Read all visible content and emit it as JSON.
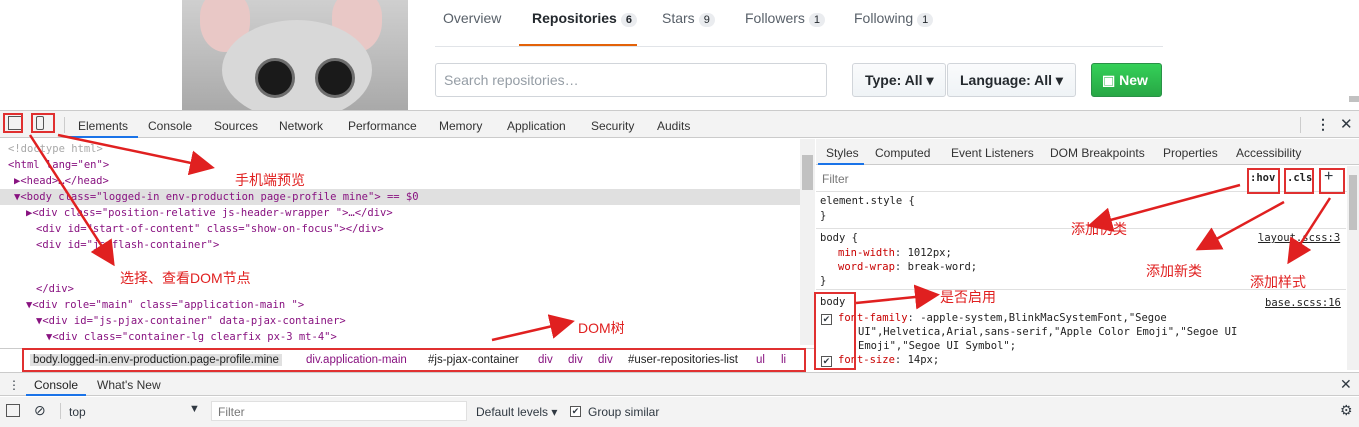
{
  "github": {
    "nav": [
      {
        "label": "Overview",
        "count": ""
      },
      {
        "label": "Repositories",
        "count": "6"
      },
      {
        "label": "Stars",
        "count": "9"
      },
      {
        "label": "Followers",
        "count": "1"
      },
      {
        "label": "Following",
        "count": "1"
      }
    ],
    "search_placeholder": "Search repositories…",
    "type_label": "Type: All ▾",
    "language_label": "Language: All ▾",
    "new_label": "New"
  },
  "devtools": {
    "tabs": [
      "Elements",
      "Console",
      "Sources",
      "Network",
      "Performance",
      "Memory",
      "Application",
      "Security",
      "Audits"
    ],
    "active_tab": "Elements",
    "dom_lines": [
      "<!doctype html>",
      "<html lang=\"en\">",
      "▶<head>…</head>",
      "▼<body class=\"logged-in env-production page-profile mine\"> == $0",
      "▶<div class=\"position-relative js-header-wrapper \">…</div>",
      "<div id=\"start-of-content\" class=\"show-on-focus\"></div>",
      "<div id=\"js-flash-container\">",
      "",
      "</div>",
      "▼<div role=\"main\" class=\"application-main \">",
      "▼<div id=\"js-pjax-container\" data-pjax-container>",
      "▼<div class=\"container-lg clearfix px-3 mt-4\">"
    ],
    "breadcrumbs": [
      "body.logged-in.env-production.page-profile.mine",
      "div.application-main",
      "#js-pjax-container",
      "div",
      "div",
      "div",
      "#user-repositories-list",
      "ul",
      "li"
    ],
    "style_tabs": [
      "Styles",
      "Computed",
      "Event Listeners",
      "DOM Breakpoints",
      "Properties",
      "Accessibility"
    ],
    "filter_placeholder": "Filter",
    "hov": ":hov",
    "cls": ".cls",
    "plus": "+",
    "rules": {
      "element_style": "element.style {",
      "close": "}",
      "body1_selector": "body {",
      "body1_src": "layout.scss:3",
      "body1_p1_name": "min-width",
      "body1_p1_val": "1012px;",
      "body1_p2_name": "word-wrap",
      "body1_p2_val": "break-word;",
      "body2_selector": "body",
      "body2_src": "base.scss:16",
      "body2_p1_name": "font-family",
      "body2_p1_val_l1": "-apple-system,BlinkMacSystemFont,\"Segoe",
      "body2_p1_val_l2": "UI\",Helvetica,Arial,sans-serif,\"Apple Color Emoji\",\"Segoe UI",
      "body2_p1_val_l3": "Emoji\",\"Segoe UI Symbol\";",
      "body2_p2_name": "font-size",
      "body2_p2_val": "14px;"
    },
    "drawer_tabs": [
      "Console",
      "What's New"
    ],
    "context": "top",
    "console_filter": "Filter",
    "default_levels": "Default levels ▾",
    "group_similar": "Group similar"
  },
  "annotations": {
    "mobile_preview": "手机端预览",
    "select_node": "选择、查看DOM节点",
    "dom_tree": "DOM树",
    "add_pseudo": "添加伪类",
    "add_class": "添加新类",
    "add_style": "添加样式",
    "enable_toggle": "是否启用"
  },
  "colors": {
    "accent_red": "#e03030",
    "github_orange": "#e36209",
    "github_green": "#28a745",
    "devtools_blue": "#1a73e8"
  }
}
